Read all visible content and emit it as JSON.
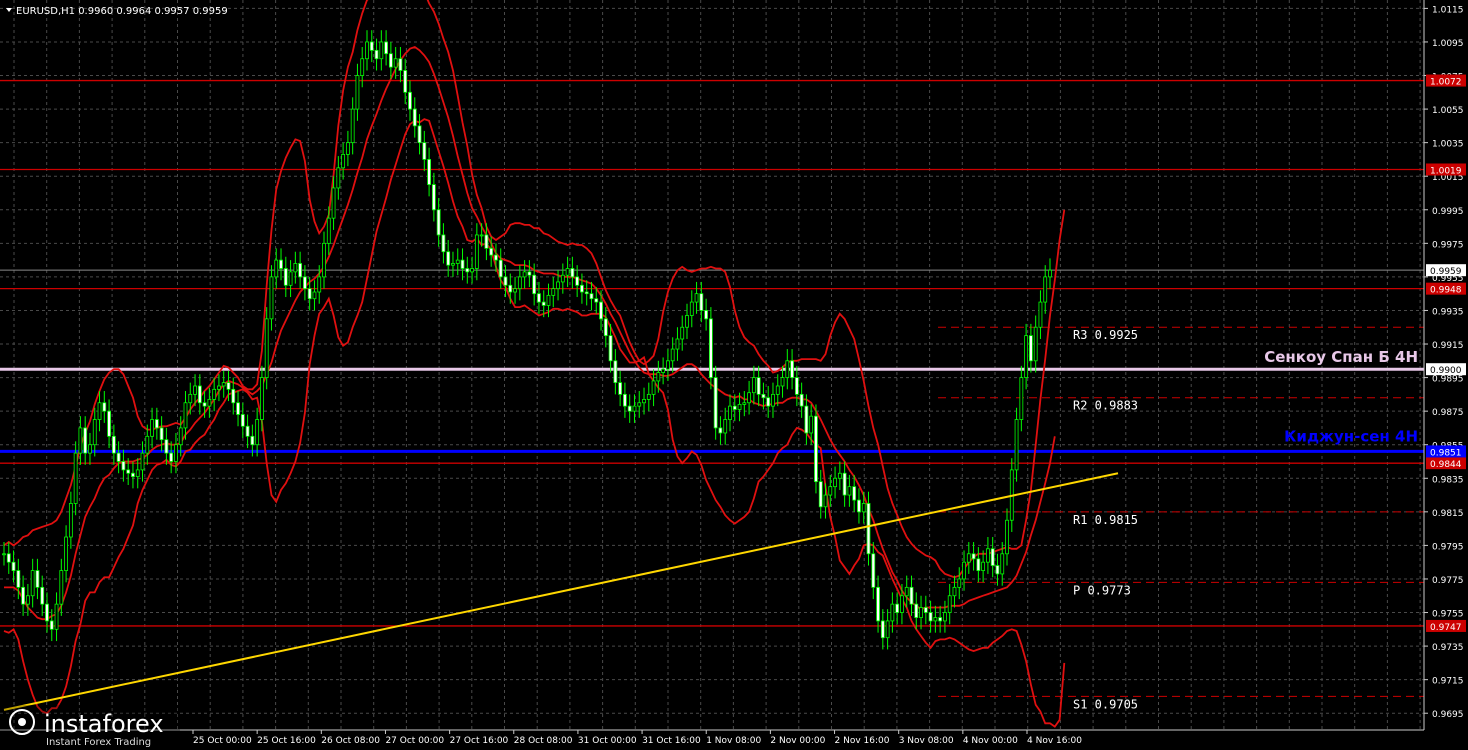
{
  "header": {
    "symbol_line": "EURUSD,H1  0.9960 0.9964 0.9957 0.9959"
  },
  "watermark": {
    "brand": "instaforex",
    "tagline": "Instant Forex Trading"
  },
  "chart_data": {
    "type": "candlestick",
    "symbol": "EURUSD",
    "timeframe": "H1",
    "ohlc_current": {
      "open": 0.996,
      "high": 0.9964,
      "low": 0.9957,
      "close": 0.9959
    },
    "ylim": [
      0.9685,
      1.012
    ],
    "y_ticks": [
      "1.0115",
      "1.0095",
      "1.0075",
      "1.0055",
      "1.0035",
      "1.0015",
      "0.9995",
      "0.9975",
      "0.9955",
      "0.9935",
      "0.9915",
      "0.9895",
      "0.9875",
      "0.9855",
      "0.9835",
      "0.9815",
      "0.9795",
      "0.9775",
      "0.9755",
      "0.9735",
      "0.9715",
      "0.9695"
    ],
    "x_labels": [
      "25 Oct 00:00",
      "25 Oct 16:00",
      "26 Oct 08:00",
      "27 Oct 00:00",
      "27 Oct 16:00",
      "28 Oct 08:00",
      "31 Oct 00:00",
      "31 Oct 16:00",
      "1 Nov 08:00",
      "2 Nov 00:00",
      "2 Nov 16:00",
      "3 Nov 08:00",
      "4 Nov 00:00",
      "4 Nov 16:00"
    ],
    "horizontal_levels": [
      {
        "price": 1.0072,
        "label": "1.0072",
        "color": "#cc0000"
      },
      {
        "price": 1.0019,
        "label": "1.0019",
        "color": "#cc0000"
      },
      {
        "price": 0.9948,
        "label": "0.9948",
        "color": "#cc0000"
      },
      {
        "price": 0.9844,
        "label": "0.9844",
        "color": "#cc0000"
      },
      {
        "price": 0.9747,
        "label": "0.9747",
        "color": "#cc0000"
      }
    ],
    "senkou_span_b": {
      "price": 0.99,
      "label": "0.9900",
      "name": "Сенкоу Спан Б 4H",
      "color": "#e8c8e8"
    },
    "kijun_sen": {
      "price": 0.9851,
      "label": "0.9851",
      "name": "Киджун-сен 4H",
      "color": "#0000ff"
    },
    "current_price": {
      "price": 0.9959,
      "label": "0.9959"
    },
    "pivots": [
      {
        "name": "R3",
        "price": 0.9925,
        "text": "R3  0.9925"
      },
      {
        "name": "R2",
        "price": 0.9883,
        "text": "R2  0.9883"
      },
      {
        "name": "R1",
        "price": 0.9815,
        "text": "R1  0.9815"
      },
      {
        "name": "P",
        "price": 0.9773,
        "text": "P  0.9773"
      },
      {
        "name": "S1",
        "price": 0.9705,
        "text": "S1  0.9705"
      }
    ],
    "trendline": {
      "color": "#ffd700",
      "from": {
        "bar": 0,
        "price": 0.9697
      },
      "to": {
        "bar": 238,
        "price": 0.9838
      }
    },
    "series": [
      {
        "name": "",
        "kind": "close",
        "values": [
          0.979,
          0.9785,
          0.978,
          0.977,
          0.976,
          0.9765,
          0.978,
          0.977,
          0.976,
          0.975,
          0.9745,
          0.976,
          0.978,
          0.98,
          0.982,
          0.985,
          0.9865,
          0.985,
          0.9855,
          0.987,
          0.988,
          0.9875,
          0.986,
          0.985,
          0.9845,
          0.984,
          0.9838,
          0.9836,
          0.984,
          0.985,
          0.986,
          0.987,
          0.9865,
          0.9858,
          0.985,
          0.9845,
          0.9855,
          0.9865,
          0.988,
          0.9885,
          0.989,
          0.988,
          0.9878,
          0.9882,
          0.9888,
          0.989,
          0.9892,
          0.9888,
          0.988,
          0.9873,
          0.9866,
          0.986,
          0.9855,
          0.987,
          0.9895,
          0.993,
          0.9955,
          0.9965,
          0.996,
          0.995,
          0.9958,
          0.9963,
          0.9955,
          0.9948,
          0.9942,
          0.9946,
          0.9955,
          0.9975,
          0.999,
          1.0008,
          1.002,
          1.0028,
          1.0035,
          1.0055,
          1.0075,
          1.0085,
          1.0095,
          1.009,
          1.0085,
          1.0095,
          1.0088,
          1.008,
          1.0085,
          1.0078,
          1.0065,
          1.0055,
          1.0045,
          1.0035,
          1.0025,
          1.001,
          0.9995,
          0.998,
          0.997,
          0.9962,
          0.9963,
          0.9965,
          0.996,
          0.9958,
          0.996,
          0.998,
          0.998,
          0.9972,
          0.9968,
          0.9965,
          0.9955,
          0.995,
          0.9946,
          0.9948,
          0.9955,
          0.9958,
          0.9956,
          0.9945,
          0.994,
          0.9938,
          0.9944,
          0.9948,
          0.9952,
          0.9956,
          0.996,
          0.9955,
          0.995,
          0.9946,
          0.9945,
          0.9942,
          0.994,
          0.993,
          0.992,
          0.9905,
          0.9892,
          0.9885,
          0.9878,
          0.9875,
          0.9878,
          0.988,
          0.9882,
          0.9885,
          0.9893,
          0.9898,
          0.99,
          0.9905,
          0.9912,
          0.9918,
          0.9925,
          0.9932,
          0.994,
          0.9945,
          0.9935,
          0.993,
          0.9895,
          0.9865,
          0.9862,
          0.987,
          0.9878,
          0.9876,
          0.9879,
          0.988,
          0.9886,
          0.9895,
          0.9885,
          0.9883,
          0.9878,
          0.9885,
          0.989,
          0.9895,
          0.9905,
          0.9895,
          0.9885,
          0.9878,
          0.9862,
          0.9872,
          0.9833,
          0.9818,
          0.9825,
          0.983,
          0.9835,
          0.9838,
          0.9825,
          0.983,
          0.9822,
          0.9815,
          0.982,
          0.979,
          0.977,
          0.975,
          0.974,
          0.975,
          0.976,
          0.9755,
          0.9765,
          0.977,
          0.976,
          0.9752,
          0.9758,
          0.9755,
          0.975,
          0.9752,
          0.975,
          0.9755,
          0.9765,
          0.977,
          0.9775,
          0.9785,
          0.979,
          0.9787,
          0.978,
          0.9785,
          0.9793,
          0.9783,
          0.9778,
          0.979,
          0.981,
          0.984,
          0.987,
          0.9895,
          0.992,
          0.9905,
          0.9925,
          0.994,
          0.9955,
          0.9959
        ]
      },
      {
        "name": "",
        "kind": "bollinger_upper",
        "values": [
          0.9795,
          0.9797,
          0.9795,
          0.9797,
          0.98,
          0.9801,
          0.9804,
          0.9805,
          0.9806,
          0.9807,
          0.9808,
          0.981,
          0.9815,
          0.9823,
          0.9831,
          0.9842,
          0.9854,
          0.9862,
          0.9869,
          0.9879,
          0.9887,
          0.9894,
          0.9898,
          0.99,
          0.99,
          0.9897,
          0.989,
          0.9883,
          0.9872,
          0.9866,
          0.9864,
          0.9864,
          0.9865,
          0.9866,
          0.9866,
          0.9867,
          0.9868,
          0.9867,
          0.9871,
          0.9876,
          0.988,
          0.9883,
          0.9887,
          0.989,
          0.9894,
          0.9898,
          0.9902,
          0.9901,
          0.9898,
          0.9895,
          0.989,
          0.9888,
          0.9888,
          0.9891,
          0.9911,
          0.995,
          0.9983,
          1.0007,
          1.0018,
          1.0026,
          1.0032,
          1.0037,
          1.0036,
          1.0024,
          1.0001,
          0.9988,
          0.9981,
          0.9985,
          0.9992,
          1.0016,
          1.0045,
          1.0066,
          1.008,
          1.0089,
          1.0102,
          1.0112,
          1.012,
          1.0122,
          1.0122,
          1.0128,
          1.0132,
          1.0133,
          1.0136,
          1.0137,
          1.0136,
          1.0136,
          1.0136,
          1.0133,
          1.0125,
          1.0118,
          1.0113,
          1.0106,
          1.0097,
          1.0089,
          1.0078,
          1.0063,
          1.0047,
          1.0033,
          1.0016,
          1.0004,
          0.9996,
          0.9985,
          0.9979,
          0.9977,
          0.9979,
          0.9981,
          0.9986,
          0.9987,
          0.9987,
          0.9986,
          0.9986,
          0.9984,
          0.9984,
          0.9981,
          0.998,
          0.9978,
          0.9976,
          0.9975,
          0.9974,
          0.9975,
          0.9974,
          0.9974,
          0.9972,
          0.9969,
          0.9963,
          0.9955,
          0.9947,
          0.9941,
          0.9936,
          0.9932,
          0.9924,
          0.9916,
          0.991,
          0.9905,
          0.9903,
          0.9905,
          0.9908,
          0.9918,
          0.9934,
          0.9946,
          0.9954,
          0.9959,
          0.9961,
          0.9959,
          0.9958,
          0.9959,
          0.996,
          0.996,
          0.9961,
          0.996,
          0.996,
          0.9958,
          0.9949,
          0.9935,
          0.9925,
          0.9919,
          0.9916,
          0.9914,
          0.9909,
          0.9905,
          0.9902,
          0.9898,
          0.9899,
          0.9901,
          0.9904,
          0.9905,
          0.9905,
          0.9906,
          0.9906,
          0.9906,
          0.9906,
          0.9905,
          0.9909,
          0.992,
          0.9928,
          0.9933,
          0.993,
          0.9924,
          0.9918,
          0.9906,
          0.9893,
          0.9878,
          0.9865,
          0.9855,
          0.9842,
          0.9829,
          0.982,
          0.9813,
          0.9806,
          0.98,
          0.9796,
          0.9793,
          0.9791,
          0.9789,
          0.9788,
          0.9786,
          0.9781,
          0.9778,
          0.9777,
          0.9776,
          0.9777,
          0.9781,
          0.9785,
          0.9788,
          0.979,
          0.979,
          0.979,
          0.9791,
          0.9792,
          0.9793,
          0.9794,
          0.9793,
          0.9793,
          0.9795,
          0.981,
          0.9828,
          0.9855,
          0.9882,
          0.9906,
          0.9932,
          0.9953,
          0.9977,
          0.9995
        ]
      },
      {
        "name": "",
        "kind": "bollinger_middle",
        "values": [
          0.977,
          0.977,
          0.977,
          0.9768,
          0.9763,
          0.9758,
          0.9755,
          0.9752,
          0.9751,
          0.9751,
          0.9753,
          0.9754,
          0.9759,
          0.9767,
          0.9777,
          0.979,
          0.9801,
          0.9812,
          0.9818,
          0.9823,
          0.983,
          0.9835,
          0.9837,
          0.9841,
          0.9844,
          0.9845,
          0.9845,
          0.9845,
          0.9846,
          0.9847,
          0.9849,
          0.9852,
          0.9854,
          0.9855,
          0.9856,
          0.9855,
          0.9855,
          0.9856,
          0.9861,
          0.9864,
          0.9868,
          0.9871,
          0.9874,
          0.9878,
          0.9882,
          0.9887,
          0.9891,
          0.9893,
          0.9892,
          0.9891,
          0.9889,
          0.9887,
          0.9885,
          0.9887,
          0.989,
          0.9897,
          0.9904,
          0.9914,
          0.9923,
          0.9929,
          0.9935,
          0.9941,
          0.9946,
          0.9949,
          0.9952,
          0.9954,
          0.9957,
          0.9961,
          0.9967,
          0.9974,
          0.9982,
          0.999,
          0.9998,
          1.0007,
          1.0017,
          1.0026,
          1.0037,
          1.0045,
          1.0052,
          1.006,
          1.0067,
          1.0073,
          1.0079,
          1.0084,
          1.0088,
          1.0091,
          1.0092,
          1.009,
          1.0087,
          1.0083,
          1.0076,
          1.0068,
          1.0059,
          1.005,
          1.0039,
          1.0027,
          1.0016,
          1.0005,
          0.9996,
          0.9991,
          0.9985,
          0.998,
          0.9975,
          0.9969,
          0.9966,
          0.9965,
          0.9964,
          0.9962,
          0.9962,
          0.9962,
          0.9961,
          0.9959,
          0.9958,
          0.9957,
          0.9957,
          0.9957,
          0.9956,
          0.9955,
          0.9955,
          0.9955,
          0.9954,
          0.9953,
          0.9952,
          0.9951,
          0.9948,
          0.9944,
          0.9939,
          0.9933,
          0.9928,
          0.9922,
          0.9916,
          0.991,
          0.9905,
          0.9901,
          0.9898,
          0.9897,
          0.9897,
          0.9897,
          0.9896,
          0.9896,
          0.9897,
          0.9899,
          0.9901,
          0.9903,
          0.9903,
          0.9901,
          0.9897,
          0.9894,
          0.9891,
          0.9889,
          0.9887,
          0.9885,
          0.9884,
          0.9883,
          0.9884,
          0.9882,
          0.9882,
          0.988,
          0.9879,
          0.9878,
          0.9879,
          0.9879,
          0.988,
          0.988,
          0.9882,
          0.9883,
          0.9883,
          0.9882,
          0.9882,
          0.988,
          0.9875,
          0.987,
          0.9864,
          0.9858,
          0.9853,
          0.9849,
          0.9845,
          0.984,
          0.9836,
          0.9831,
          0.9825,
          0.9817,
          0.981,
          0.9801,
          0.9793,
          0.9786,
          0.9779,
          0.9774,
          0.9768,
          0.9764,
          0.9761,
          0.9759,
          0.9757,
          0.9758,
          0.9758,
          0.9758,
          0.9758,
          0.9758,
          0.9759,
          0.9759,
          0.9759,
          0.976,
          0.9762,
          0.9763,
          0.9764,
          0.9765,
          0.9766,
          0.9767,
          0.9768,
          0.9769,
          0.977,
          0.9773,
          0.9777,
          0.9784,
          0.9791,
          0.9801,
          0.981,
          0.9821,
          0.9832,
          0.9844,
          0.986
        ]
      },
      {
        "name": "",
        "kind": "bollinger_lower",
        "values": [
          0.9744,
          0.9743,
          0.9745,
          0.9739,
          0.9726,
          0.9715,
          0.9706,
          0.9699,
          0.9696,
          0.9695,
          0.9698,
          0.9698,
          0.9703,
          0.9711,
          0.9723,
          0.9738,
          0.9748,
          0.9762,
          0.9767,
          0.9767,
          0.9773,
          0.9776,
          0.9776,
          0.9782,
          0.9788,
          0.9793,
          0.98,
          0.9807,
          0.982,
          0.9828,
          0.9834,
          0.984,
          0.9843,
          0.9844,
          0.9846,
          0.9843,
          0.9842,
          0.9845,
          0.9851,
          0.9852,
          0.9856,
          0.9859,
          0.9861,
          0.9866,
          0.987,
          0.9876,
          0.988,
          0.9885,
          0.9886,
          0.9887,
          0.9888,
          0.9886,
          0.9882,
          0.9883,
          0.9869,
          0.9844,
          0.9825,
          0.9821,
          0.9828,
          0.9832,
          0.9838,
          0.9845,
          0.9856,
          0.9874,
          0.9903,
          0.992,
          0.9933,
          0.9937,
          0.9942,
          0.9932,
          0.9919,
          0.9914,
          0.9916,
          0.9925,
          0.9932,
          0.994,
          0.9954,
          0.9968,
          0.9982,
          0.9992,
          1.0002,
          1.0013,
          1.0022,
          1.0031,
          1.004,
          1.0046,
          1.0048,
          1.0047,
          1.0049,
          1.0048,
          1.0039,
          1.003,
          1.0021,
          1.0011,
          1.0,
          0.9991,
          0.9985,
          0.9977,
          0.9976,
          0.9978,
          0.9974,
          0.9975,
          0.9971,
          0.9961,
          0.9953,
          0.9949,
          0.9942,
          0.9937,
          0.9937,
          0.9938,
          0.9936,
          0.9934,
          0.9932,
          0.9933,
          0.9934,
          0.9936,
          0.9936,
          0.9935,
          0.9936,
          0.9935,
          0.9934,
          0.9932,
          0.9932,
          0.9933,
          0.9933,
          0.9933,
          0.9931,
          0.9925,
          0.9919,
          0.9912,
          0.9908,
          0.9904,
          0.9904,
          0.9905,
          0.9907,
          0.9897,
          0.9893,
          0.9889,
          0.9886,
          0.9876,
          0.9858,
          0.9848,
          0.9844,
          0.9847,
          0.9851,
          0.9849,
          0.9843,
          0.9834,
          0.9828,
          0.9822,
          0.9818,
          0.9813,
          0.981,
          0.9808,
          0.981,
          0.9812,
          0.9815,
          0.9823,
          0.9833,
          0.9836,
          0.984,
          0.9844,
          0.985,
          0.9853,
          0.9855,
          0.9861,
          0.9865,
          0.9864,
          0.9862,
          0.9858,
          0.9855,
          0.9853,
          0.983,
          0.9812,
          0.98,
          0.9786,
          0.9782,
          0.9778,
          0.9783,
          0.9787,
          0.9795,
          0.9796,
          0.9795,
          0.9791,
          0.9789,
          0.9782,
          0.9775,
          0.9769,
          0.9763,
          0.9758,
          0.975,
          0.9745,
          0.9741,
          0.9737,
          0.9734,
          0.9738,
          0.9739,
          0.9739,
          0.974,
          0.9739,
          0.9737,
          0.9735,
          0.9733,
          0.9732,
          0.9733,
          0.9734,
          0.9734,
          0.9737,
          0.9739,
          0.9741,
          0.9744,
          0.9745,
          0.9744,
          0.9736,
          0.9726,
          0.9712,
          0.97,
          0.9696,
          0.9689,
          0.9689,
          0.9687,
          0.9691,
          0.9725
        ]
      }
    ]
  }
}
